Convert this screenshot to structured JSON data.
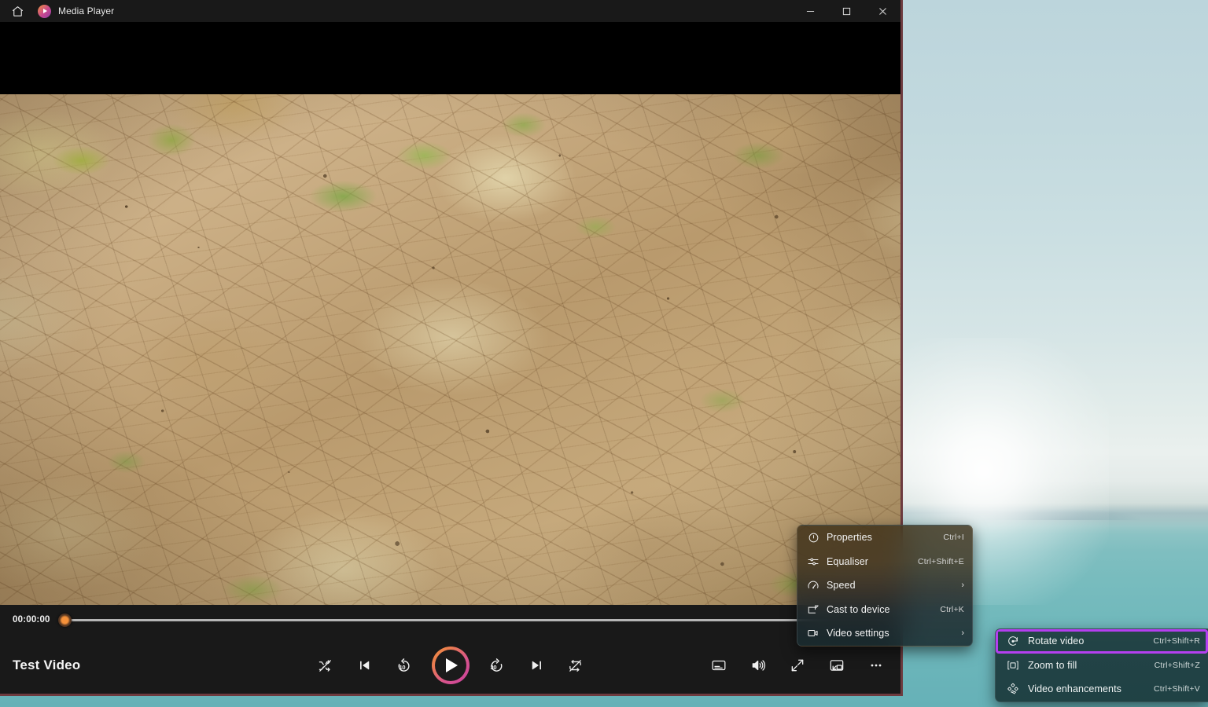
{
  "window": {
    "app_title": "Media Player",
    "home_icon": "home-icon",
    "logo_icon": "media-player-logo-icon",
    "controls": {
      "minimize": "minimize-icon",
      "maximize": "maximize-icon",
      "close": "close-icon"
    }
  },
  "player": {
    "current_time": "00:00:00",
    "progress_percent": 0,
    "track_title": "Test Video",
    "accent_start": "#f0913c",
    "accent_end": "#c93f9e",
    "thumb_color": "#f5913a",
    "transport": [
      {
        "name": "shuffle-off-icon",
        "label": "Shuffle"
      },
      {
        "name": "previous-track-icon",
        "label": "Previous"
      },
      {
        "name": "rewind-10-icon",
        "label": "Rewind 10 seconds",
        "num": "10"
      },
      {
        "name": "play-icon",
        "label": "Play"
      },
      {
        "name": "forward-30-icon",
        "label": "Forward 30 seconds",
        "num": "30"
      },
      {
        "name": "next-track-icon",
        "label": "Next"
      },
      {
        "name": "repeat-off-icon",
        "label": "Repeat off"
      }
    ],
    "right_controls": [
      {
        "name": "captions-icon",
        "label": "Subtitles / Captions"
      },
      {
        "name": "volume-icon",
        "label": "Volume"
      },
      {
        "name": "fullscreen-icon",
        "label": "Full screen"
      },
      {
        "name": "mini-player-icon",
        "label": "Mini player"
      },
      {
        "name": "more-options-icon",
        "label": "More options"
      }
    ]
  },
  "context_menu": {
    "items": [
      {
        "icon": "info-circle-icon",
        "label": "Properties",
        "shortcut": "Ctrl+I",
        "submenu": false
      },
      {
        "icon": "equalizer-icon",
        "label": "Equaliser",
        "shortcut": "Ctrl+Shift+E",
        "submenu": false
      },
      {
        "icon": "speed-gauge-icon",
        "label": "Speed",
        "shortcut": "",
        "submenu": true
      },
      {
        "icon": "cast-icon",
        "label": "Cast to device",
        "shortcut": "Ctrl+K",
        "submenu": false
      },
      {
        "icon": "video-camera-icon",
        "label": "Video settings",
        "shortcut": "",
        "submenu": true
      }
    ],
    "chevron": "›"
  },
  "submenu": {
    "highlight_color": "#b43ff0",
    "items": [
      {
        "icon": "rotate-video-icon",
        "label": "Rotate video",
        "shortcut": "Ctrl+Shift+R",
        "highlighted": true
      },
      {
        "icon": "zoom-to-fill-icon",
        "label": "Zoom to fill",
        "shortcut": "Ctrl+Shift+Z",
        "highlighted": false
      },
      {
        "icon": "video-enhancements-icon",
        "label": "Video enhancements",
        "shortcut": "Ctrl+Shift+V",
        "highlighted": false
      }
    ]
  },
  "desktop": {
    "wallpaper_description": "hazy seascape with sun glow, distant hills and teal water"
  }
}
